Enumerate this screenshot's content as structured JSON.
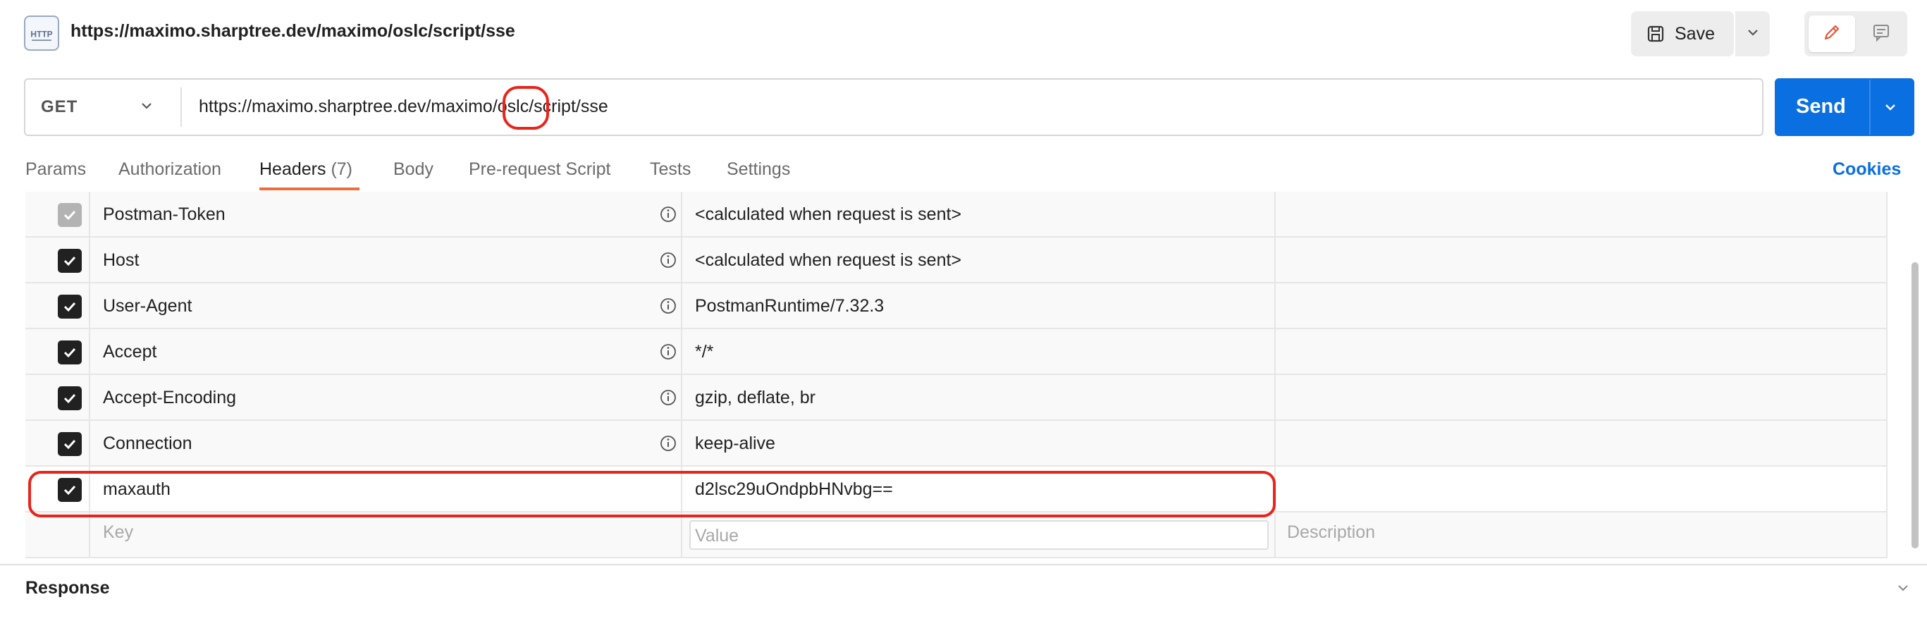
{
  "header": {
    "title": "https://maximo.sharptree.dev/maximo/oslc/script/sse",
    "save_label": "Save",
    "icons": [
      "http-icon",
      "save-icon",
      "chevron-down-icon",
      "pencil-icon",
      "comment-icon"
    ]
  },
  "request": {
    "method": "GET",
    "url": "https://maximo.sharptree.dev/maximo/oslc/script/sse",
    "send_label": "Send"
  },
  "tabs": {
    "params": "Params",
    "authorization": "Authorization",
    "headers": "Headers",
    "headers_count": "(7)",
    "body": "Body",
    "prerequest": "Pre-request Script",
    "tests": "Tests",
    "settings": "Settings",
    "active": "Headers",
    "cookies": "Cookies"
  },
  "headers_table": {
    "rows": [
      {
        "key": "Postman-Token",
        "value": "<calculated when request is sent>",
        "checked": true,
        "disabled": true
      },
      {
        "key": "Host",
        "value": "<calculated when request is sent>",
        "checked": true,
        "disabled": false
      },
      {
        "key": "User-Agent",
        "value": "PostmanRuntime/7.32.3",
        "checked": true,
        "disabled": false
      },
      {
        "key": "Accept",
        "value": "*/*",
        "checked": true,
        "disabled": false
      },
      {
        "key": "Accept-Encoding",
        "value": "gzip, deflate, br",
        "checked": true,
        "disabled": false
      },
      {
        "key": "Connection",
        "value": "keep-alive",
        "checked": true,
        "disabled": false
      },
      {
        "key": "maxauth",
        "value": "d2lsc29uOndpbHNvbg==",
        "checked": true,
        "disabled": false
      }
    ],
    "new_row": {
      "key_placeholder": "Key",
      "value_placeholder": "Value",
      "description_placeholder": "Description"
    }
  },
  "response": {
    "label": "Response"
  },
  "colors": {
    "accent": "#0a6fe0",
    "active_tab": "#f26b3a",
    "highlight": "#e8251c"
  }
}
